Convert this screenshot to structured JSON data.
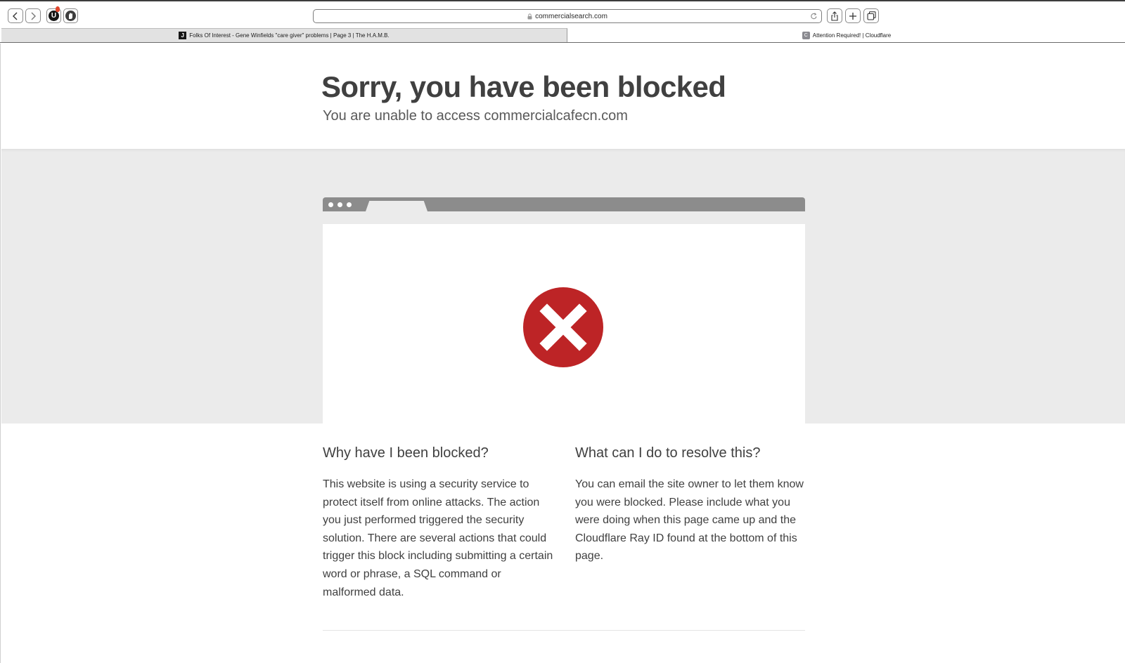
{
  "browser": {
    "url": "commercialsearch.com",
    "tabs": [
      {
        "label": "Folks Of Interest - Gene Winfields \"care giver\" problems | Page 3 | The H.A.M.B.",
        "favicon": "J",
        "active": false
      },
      {
        "label": "Attention Required! | Cloudflare",
        "favicon": "C",
        "active": true
      }
    ],
    "extensions": [
      {
        "name": "ublock-origin-icon",
        "glyph": "U"
      },
      {
        "name": "adblock-hand-icon"
      }
    ]
  },
  "page": {
    "title": "Sorry, you have been blocked",
    "subtitle": "You are unable to access commercialcafecn.com",
    "why": {
      "heading": "Why have I been blocked?",
      "body": "This website is using a security service to protect itself from online attacks. The action you just performed triggered the security solution. There are several actions that could trigger this block including submitting a certain word or phrase, a SQL command or malformed data."
    },
    "resolve": {
      "heading": "What can I do to resolve this?",
      "body": "You can email the site owner to let them know you were blocked. Please include what you were doing when this page came up and the Cloudflare Ray ID found at the bottom of this page."
    }
  },
  "colors": {
    "error_red": "#bd2426",
    "band_gray": "#ebebeb",
    "window_bar": "#8c8c8c",
    "text": "#404040"
  },
  "icons": [
    "back-arrow-icon",
    "forward-arrow-icon",
    "lock-icon",
    "reload-icon",
    "share-icon",
    "new-tab-plus-icon",
    "tab-overview-icon",
    "error-x-icon"
  ]
}
